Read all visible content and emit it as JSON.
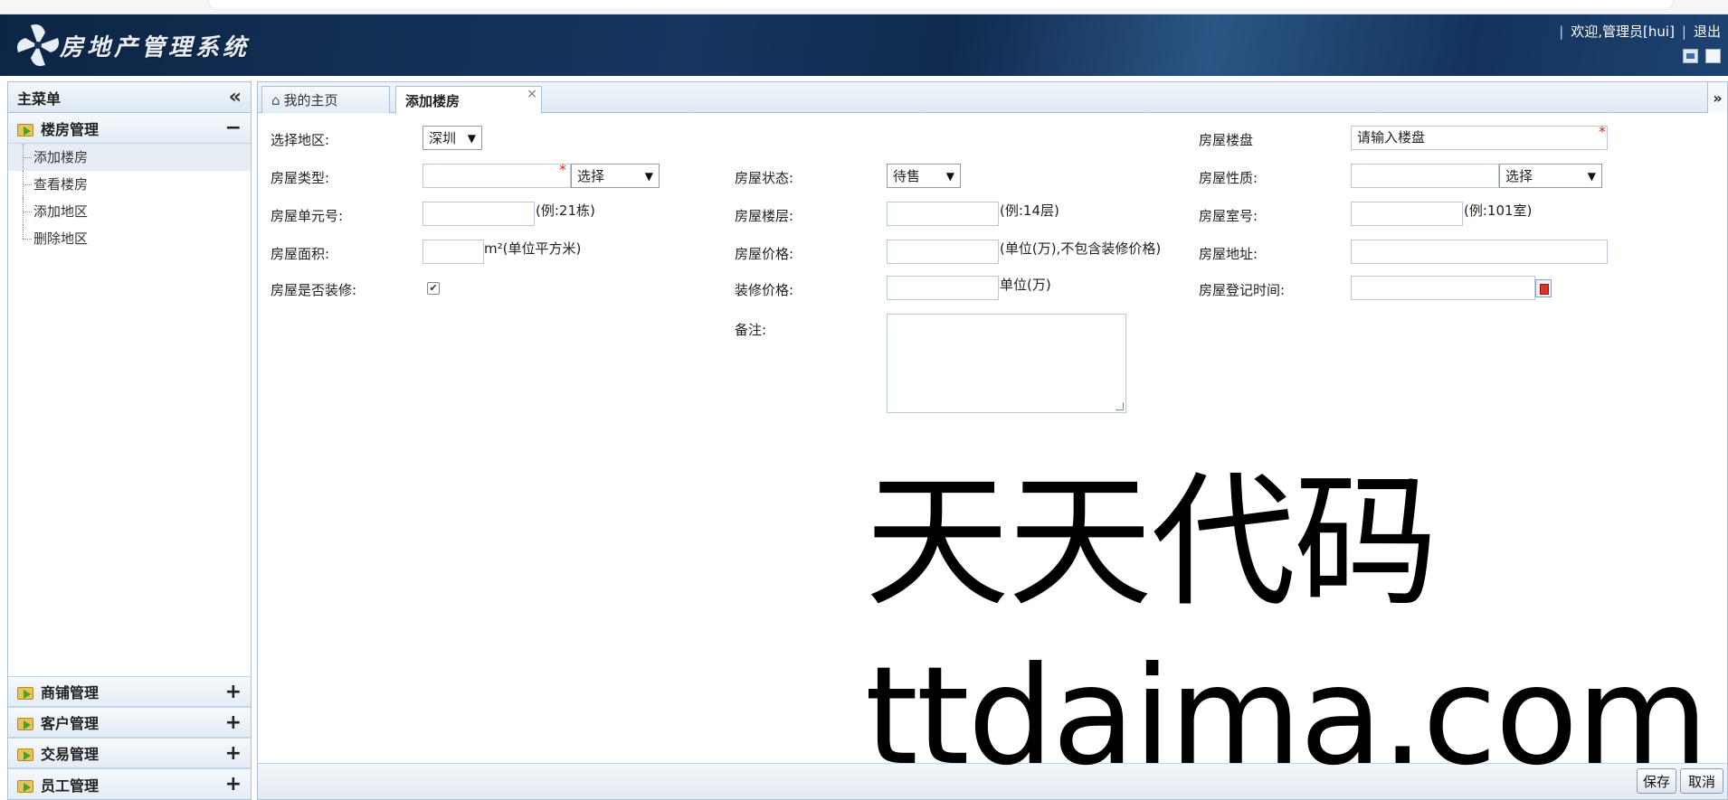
{
  "app": {
    "title": "房地产管理系统",
    "welcome": "欢迎,管理员[hui]",
    "logout": "退出"
  },
  "sidebar": {
    "title": "主菜单",
    "groups": [
      {
        "label": "楼房管理",
        "toggle": "−",
        "items": [
          "添加楼房",
          "查看楼房",
          "添加地区",
          "删除地区"
        ]
      },
      {
        "label": "商铺管理",
        "toggle": "+"
      },
      {
        "label": "客户管理",
        "toggle": "+"
      },
      {
        "label": "交易管理",
        "toggle": "+"
      },
      {
        "label": "员工管理",
        "toggle": "+"
      }
    ]
  },
  "tabs": [
    {
      "label": "我的主页"
    },
    {
      "label": "添加楼房"
    }
  ],
  "form": {
    "region_label": "选择地区:",
    "region_value": "深圳",
    "estate_label": "房屋楼盘",
    "estate_value": "请输入楼盘",
    "type_label": "房屋类型:",
    "type_select": "选择",
    "status_label": "房屋状态:",
    "status_value": "待售",
    "nature_label": "房屋性质:",
    "nature_select": "选择",
    "unit_label": "房屋单元号:",
    "unit_hint": "(例:21栋)",
    "floor_label": "房屋楼层:",
    "floor_hint": "(例:14层)",
    "room_label": "房屋室号:",
    "room_hint": "(例:101室)",
    "area_label": "房屋面积:",
    "area_hint": "m²(单位平方米)",
    "price_label": "房屋价格:",
    "price_hint": "(单位(万),不包含装修价格)",
    "address_label": "房屋地址:",
    "decorated_label": "房屋是否装修:",
    "decorated_checked": true,
    "deco_price_label": "装修价格:",
    "deco_price_hint": "单位(万)",
    "reg_time_label": "房屋登记时间:",
    "remark_label": "备注:",
    "required_mark": "*"
  },
  "buttons": {
    "save": "保存",
    "cancel": "取消"
  },
  "watermark": {
    "line1": "天天代码",
    "line2": "ttdaima.com"
  }
}
